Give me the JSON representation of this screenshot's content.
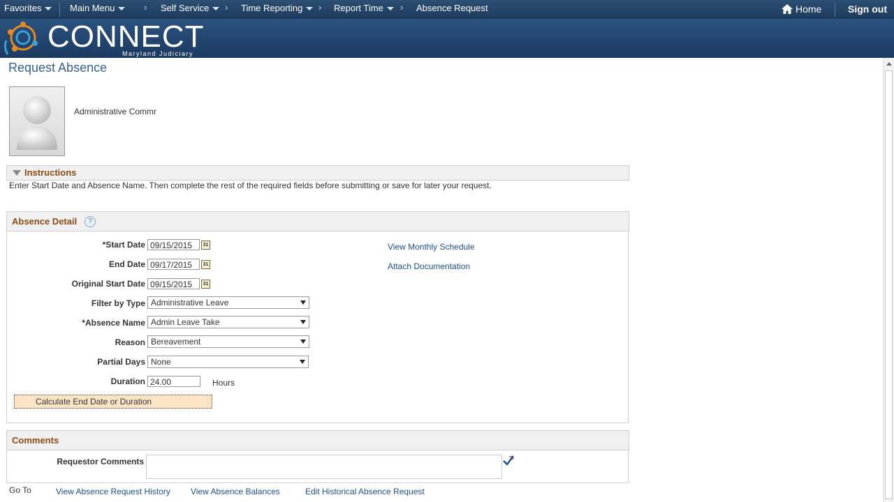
{
  "topnav": {
    "favorites": "Favorites",
    "main_menu": "Main Menu",
    "breadcrumbs": [
      "Self Service",
      "Time Reporting",
      "Report Time"
    ],
    "current": "Absence Request",
    "home": "Home",
    "sign_out": "Sign out"
  },
  "banner": {
    "logo_text": "CONNECT",
    "logo_sub": "Maryland Judiciary"
  },
  "page_title": "Request Absence",
  "employee": {
    "name": "Administrative Commr"
  },
  "instructions": {
    "title": "Instructions",
    "text": "Enter Start Date and Absence Name. Then complete the rest of the required fields before submitting or save for later your request."
  },
  "absence_detail": {
    "title": "Absence Detail",
    "help_icon": "?",
    "start_date": {
      "label": "*Start Date",
      "value": "09/15/2015"
    },
    "end_date": {
      "label": "End Date",
      "value": "09/17/2015"
    },
    "original_start_date": {
      "label": "Original Start Date",
      "value": "09/15/2015"
    },
    "filter_by_type": {
      "label": "Filter by Type",
      "value": "Administrative Leave"
    },
    "absence_name": {
      "label": "*Absence Name",
      "value": "Admin Leave Take"
    },
    "reason": {
      "label": "Reason",
      "value": "Bereavement"
    },
    "partial_days": {
      "label": "Partial Days",
      "value": "None"
    },
    "duration": {
      "label": "Duration",
      "value": "24.00",
      "unit": "Hours"
    },
    "calc_button": "Calculate End Date or Duration",
    "view_monthly_schedule": "View Monthly Schedule",
    "attach_documentation": "Attach Documentation",
    "calendar_icon_text": "31"
  },
  "comments": {
    "title": "Comments",
    "requestor_label": "Requestor Comments",
    "requestor_value": ""
  },
  "goto": {
    "label": "Go To",
    "links": [
      "View Absence Request History",
      "View Absence Balances",
      "Edit Historical Absence Request"
    ]
  },
  "colors": {
    "nav_bg": "#1d3a5c",
    "section_title": "#8c4a14",
    "link": "#1e4f8a",
    "button_bg": "#fbe4c6"
  }
}
